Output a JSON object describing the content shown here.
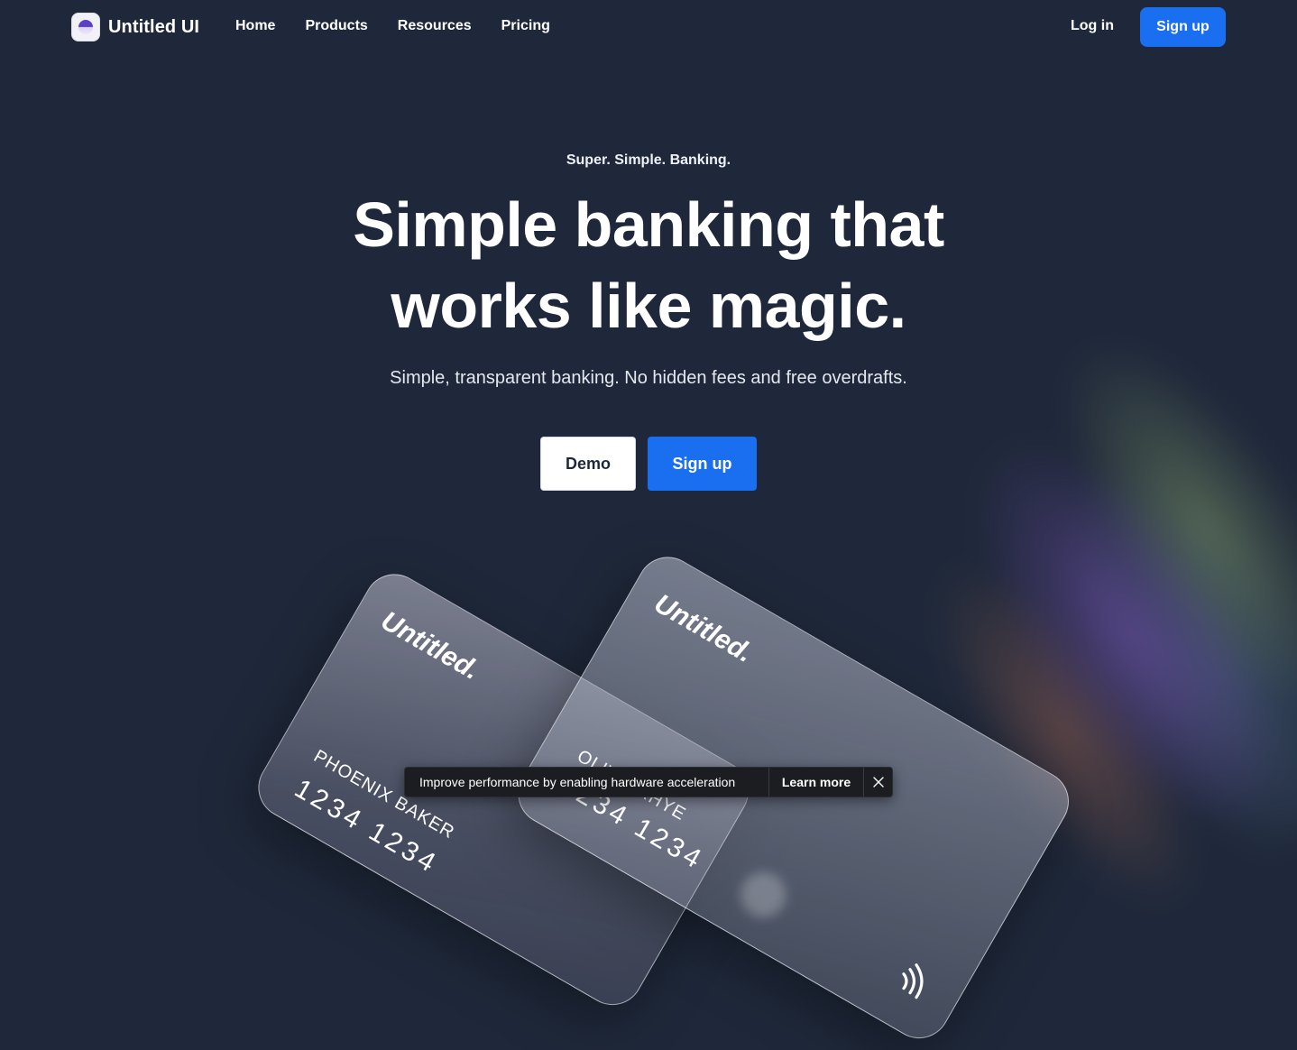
{
  "nav": {
    "brand": "Untitled UI",
    "links": [
      "Home",
      "Products",
      "Resources",
      "Pricing"
    ],
    "login": "Log in",
    "signup": "Sign up"
  },
  "hero": {
    "eyebrow": "Super. Simple. Banking.",
    "headline_line1": "Simple banking that",
    "headline_line2": "works like magic.",
    "subtitle": "Simple, transparent banking. No hidden fees and free overdrafts.",
    "demo_button": "Demo",
    "signup_button": "Sign up"
  },
  "cards": [
    {
      "brand": "Untitled.",
      "holder": "PHOENIX BAKER",
      "number": "1234 1234"
    },
    {
      "brand": "Untitled.",
      "holder": "OLIVIA RHYE",
      "number": "1234 1234"
    }
  ],
  "toast": {
    "message": "Improve performance by enabling hardware acceleration",
    "link": "Learn more"
  },
  "colors": {
    "background": "#1f283a",
    "primary": "#1a6ff0",
    "toast_bg": "#1c1d21"
  },
  "icons": [
    "logo-mark-icon",
    "contactless-icon",
    "close-icon"
  ]
}
